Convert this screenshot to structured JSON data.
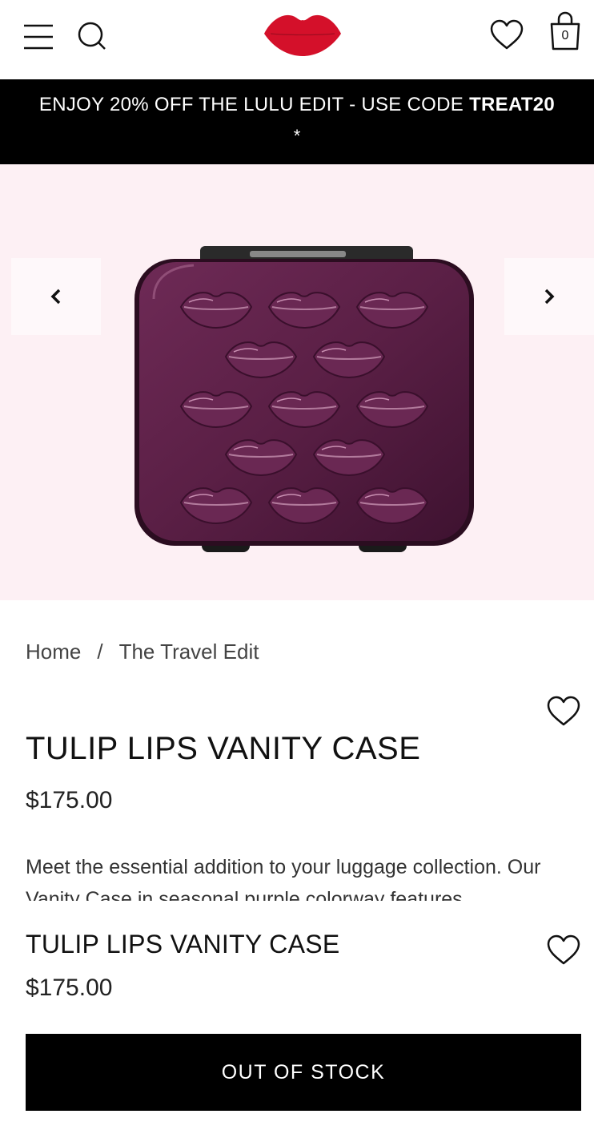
{
  "header": {
    "bag_count": "0"
  },
  "promo": {
    "text": "ENJOY 20% OFF THE LULU EDIT - USE CODE ",
    "code": "TREAT20",
    "footnote": "*"
  },
  "breadcrumb": {
    "home": "Home",
    "separator": "/",
    "current": "The Travel Edit"
  },
  "product": {
    "title": "TULIP LIPS VANITY CASE",
    "price": "$175.00",
    "description": "Meet the essential addition to your luggage collection. Our Vanity Case in seasonal purple colorway features"
  },
  "sticky_bar": {
    "title": "TULIP LIPS VANITY CASE",
    "price": "$175.00",
    "button_label": "OUT OF STOCK"
  },
  "colors": {
    "brand_red": "#d4102a",
    "banner_bg": "#000000",
    "gallery_bg": "#fdf0f4",
    "case_purple": "#5a1f45"
  }
}
